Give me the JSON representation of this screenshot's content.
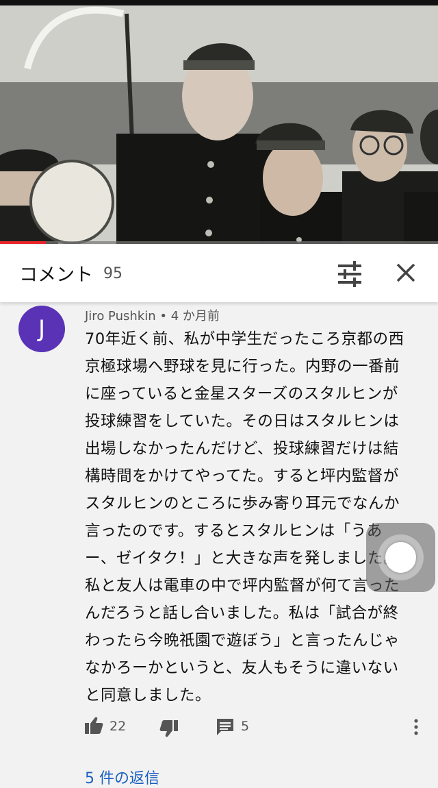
{
  "video": {
    "progress_fraction": 0.105
  },
  "comments_header": {
    "title": "コメント",
    "count": "95",
    "filter_icon": "tune-icon",
    "close_icon": "close-icon"
  },
  "comment": {
    "avatar_letter": "J",
    "avatar_color": "#5a32b6",
    "author": "Jiro Pushkin",
    "time": "4 か月前",
    "lines": [
      "70年近く前、私が中学生だったころ京都の西",
      "京極球場へ野球を見に行った。内野の一番前",
      "に座っていると金星スターズのスタルヒンが",
      "投球練習をしていた。その日はスタルヒンは",
      "出場しなかったんだけど、投球練習だけは結",
      "構時間をかけてやってた。すると坪内監督が",
      "スタルヒンのところに歩み寄り耳元でなんか",
      "言ったのです。するとスタルヒンは「うあ",
      "ー、ゼイタク！」と大きな声を発しました。",
      "私と友人は電車の中で坪内監督が何て言った",
      "んだろうと話し合いました。私は「試合が終",
      "わったら今晩祇園で遊ぼう」と言ったんじゃ",
      "なかろーかというと、友人もそうに違いない",
      "と同意しました。"
    ],
    "likes": "22",
    "replies_count": "5",
    "view_replies": "5 件の返信",
    "like_icon": "thumbs-up-icon",
    "dislike_icon": "thumbs-down-icon",
    "reply_icon": "comment-icon",
    "more_icon": "more-vert-icon"
  },
  "colors": {
    "accent_red": "#e8262a",
    "link_blue": "#1a5fc1"
  }
}
